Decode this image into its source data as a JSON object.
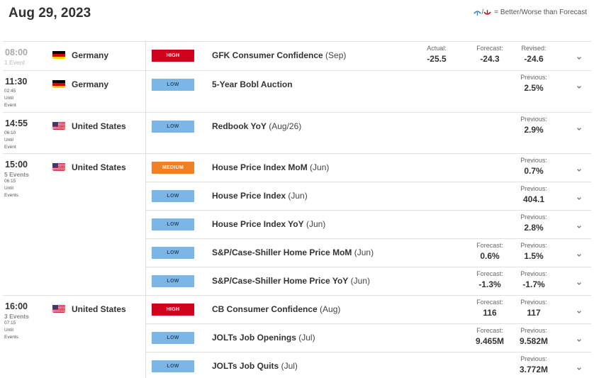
{
  "header": {
    "date": "Aug 29, 2023",
    "legend_text": "= Better/Worse than Forecast",
    "legend_sep": "/"
  },
  "labels": {
    "actual": "Actual:",
    "forecast": "Forecast:",
    "revised": "Revised:",
    "previous": "Previous:",
    "until": "Until",
    "event": "Event",
    "events": "Events"
  },
  "colors": {
    "high": "#d0021b",
    "low": "#7cb6e7",
    "medium": "#f08025"
  },
  "groups": [
    {
      "time": "08:00",
      "sub": "1 Event",
      "country": "Germany",
      "flag": "germany-flag-icon",
      "events": [
        {
          "impact": "HIGH",
          "name": "GFK Consumer Confidence",
          "period": "(Sep)",
          "actual": "-25.5",
          "forecast": "-24.3",
          "revised": "-24.6"
        }
      ]
    },
    {
      "time": "11:30",
      "countdown": "02:45",
      "country": "Germany",
      "flag": "germany-flag-icon",
      "events": [
        {
          "impact": "LOW",
          "name": "5-Year Bobl Auction",
          "period": "",
          "previous": "2.5%"
        }
      ]
    },
    {
      "time": "14:55",
      "countdown": "06:10",
      "country": "United States",
      "flag": "usa-flag-icon",
      "events": [
        {
          "impact": "LOW",
          "name": "Redbook YoY",
          "period": "(Aug/26)",
          "previous": "2.9%"
        }
      ]
    },
    {
      "time": "15:00",
      "sub": "5 Events",
      "countdown": "06:15",
      "country": "United States",
      "flag": "usa-flag-icon",
      "events": [
        {
          "impact": "MEDIUM",
          "name": "House Price Index MoM",
          "period": "(Jun)",
          "previous": "0.7%"
        },
        {
          "impact": "LOW",
          "name": "House Price Index",
          "period": "(Jun)",
          "previous": "404.1"
        },
        {
          "impact": "LOW",
          "name": "House Price Index YoY",
          "period": "(Jun)",
          "previous": "2.8%"
        },
        {
          "impact": "LOW",
          "name": "S&P/Case-Shiller Home Price MoM",
          "period": "(Jun)",
          "forecast": "0.6%",
          "previous": "1.5%"
        },
        {
          "impact": "LOW",
          "name": "S&P/Case-Shiller Home Price YoY",
          "period": "(Jun)",
          "forecast": "-1.3%",
          "previous": "-1.7%"
        }
      ]
    },
    {
      "time": "16:00",
      "sub": "3 Events",
      "countdown": "07:15",
      "country": "United States",
      "flag": "usa-flag-icon",
      "events": [
        {
          "impact": "HIGH",
          "name": "CB Consumer Confidence",
          "period": "(Aug)",
          "forecast": "116",
          "previous": "117"
        },
        {
          "impact": "LOW",
          "name": "JOLTs Job Openings",
          "period": "(Jul)",
          "forecast": "9.465M",
          "previous": "9.582M"
        },
        {
          "impact": "LOW",
          "name": "JOLTs Job Quits",
          "period": "(Jul)",
          "previous": "3.772M"
        }
      ]
    }
  ]
}
